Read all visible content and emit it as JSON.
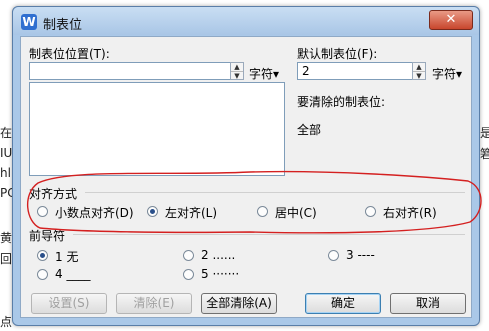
{
  "background_doc": {
    "lines": [
      "在",
      "IU",
      "hl",
      "PC",
      "黄",
      "回",
      "点",
      "是",
      "箬"
    ]
  },
  "dialog": {
    "title": "制表位",
    "close_glyph": "✕",
    "tab_position_label": "制表位位置(T):",
    "tab_position_value": "",
    "unit_label": "字符▾",
    "default_tab_label": "默认制表位(F):",
    "default_tab_value": "2",
    "default_unit_label": "字符▾",
    "to_clear_label": "要清除的制表位:",
    "to_clear_value": "全部",
    "alignment": {
      "title": "对齐方式",
      "options": [
        {
          "label": "小数点对齐(D)",
          "selected": false
        },
        {
          "label": "左对齐(L)",
          "selected": true
        },
        {
          "label": "居中(C)",
          "selected": false
        },
        {
          "label": "右对齐(R)",
          "selected": false
        }
      ]
    },
    "leader": {
      "title": "前导符",
      "options": [
        {
          "label": "1 无",
          "selected": true
        },
        {
          "label": "2 ......",
          "selected": false
        },
        {
          "label": "3 ----",
          "selected": false
        },
        {
          "label": "4 ____",
          "selected": false
        },
        {
          "label": "5 ·······",
          "selected": false
        }
      ]
    },
    "buttons": {
      "set": "设置(S)",
      "clear": "清除(E)",
      "clear_all": "全部清除(A)",
      "ok": "确定",
      "cancel": "取消"
    }
  },
  "colors": {
    "annotation_red": "#d42020"
  }
}
